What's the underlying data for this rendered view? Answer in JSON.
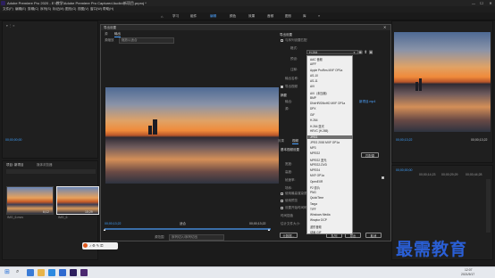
{
  "window": {
    "title": "Adobe Premiere Pro 2020 - E:\\教学\\Adobe Premiere Pro Captured Audio\\新项目.prproj *",
    "min": "—",
    "max": "☐",
    "close": "✕"
  },
  "menu": [
    "文件(F)",
    "编辑(E)",
    "剪辑(C)",
    "序列(S)",
    "标记(M)",
    "图形(G)",
    "视图(V)",
    "窗口(W)",
    "帮助(H)"
  ],
  "workspaces": [
    "学习",
    "组件",
    "编辑",
    "颜色",
    "效果",
    "音频",
    "图形",
    "库"
  ],
  "workspace_active": "编辑",
  "left_panel": {
    "timecode": "00;00;00;00"
  },
  "project_panel": {
    "tabs": [
      "项目: 新项目",
      "媒体浏览器"
    ],
    "thumbs": [
      {
        "label": "IMG_6.mov",
        "dur": "6;12"
      },
      {
        "label": "IMG_6",
        "dur": "15;29"
      }
    ]
  },
  "export_dialog": {
    "title": "导出设置",
    "tabs": [
      "源",
      "输出"
    ],
    "source_scaling_label": "源缩放",
    "source_scaling_value": "缩放以适合",
    "tc_in": "00;00;13;22",
    "tc_out": "00;00;13;22",
    "fit_label": "适合",
    "range_label": "源范围",
    "range_value": "序列切入/序列切出",
    "settings_title": "导出设置",
    "match_sequence": "与序列设置匹配",
    "format_label": "格式:",
    "preset_label": "预设:",
    "comments_label": "注释:",
    "output_name_label": "输出名称:",
    "export_video": "导出视频",
    "summary_label": "摘要",
    "output_label": "输出:",
    "source_label": "源:",
    "output_file": "新项目.mp4",
    "tabs2": [
      "效果",
      "视频"
    ],
    "basic_settings": "基本视频设置",
    "width_label": "宽度:",
    "height_label": "高度:",
    "fps_label": "帧速率:",
    "field_label": "场序:",
    "render_max": "使用最高渲染质量",
    "use_preview": "使用预览",
    "set_start": "设置开始时间码",
    "time_interp_label": "时间插值",
    "file_size_label": "估计文件大小:",
    "metadata_btn": "元数据...",
    "queue_btn": "队列",
    "export_btn": "导出",
    "cancel_btn": "取消",
    "match_source_btn": "匹配源"
  },
  "format_dropdown": {
    "current": "H.264",
    "items": [
      "AAC 音频",
      "AIFF",
      "Apple ProRes MXF OP1a",
      "AS-10",
      "AS-11",
      "AVI",
      "AVI（未压缩）",
      "BMP",
      "DNxHR/DNxHD MXF OP1a",
      "DPX",
      "GIF",
      "H.264",
      "H.264 蓝光",
      "HEVC (H.265)",
      "JPEG",
      "JPEG 2000 MXF OP1a",
      "MP3",
      "MPEG2",
      "MPEG2 蓝光",
      "MPEG2-DVD",
      "MPEG4",
      "MXF OP1a",
      "OpenEXR",
      "P2 影片",
      "PNG",
      "QuickTime",
      "Targa",
      "TIFF",
      "Windows Media",
      "Wraptor DCP",
      "波形音频",
      "动画 GIF"
    ],
    "selected_index": 14
  },
  "program_monitor": {
    "timecode_left": "00;00;13;22",
    "timecode_right": "00;00;13;22"
  },
  "timeline": {
    "timecode": "00;00;00;00",
    "ruler": [
      "00;00;14;23",
      "00;00;29;29",
      "00;00;44;28"
    ]
  },
  "taskbar": {
    "time": "12:07",
    "date": "2021/5/17"
  },
  "watermark": "最需教育",
  "colors": {
    "accent": "#3fa1ff",
    "watermark": "#2a5fd6"
  }
}
